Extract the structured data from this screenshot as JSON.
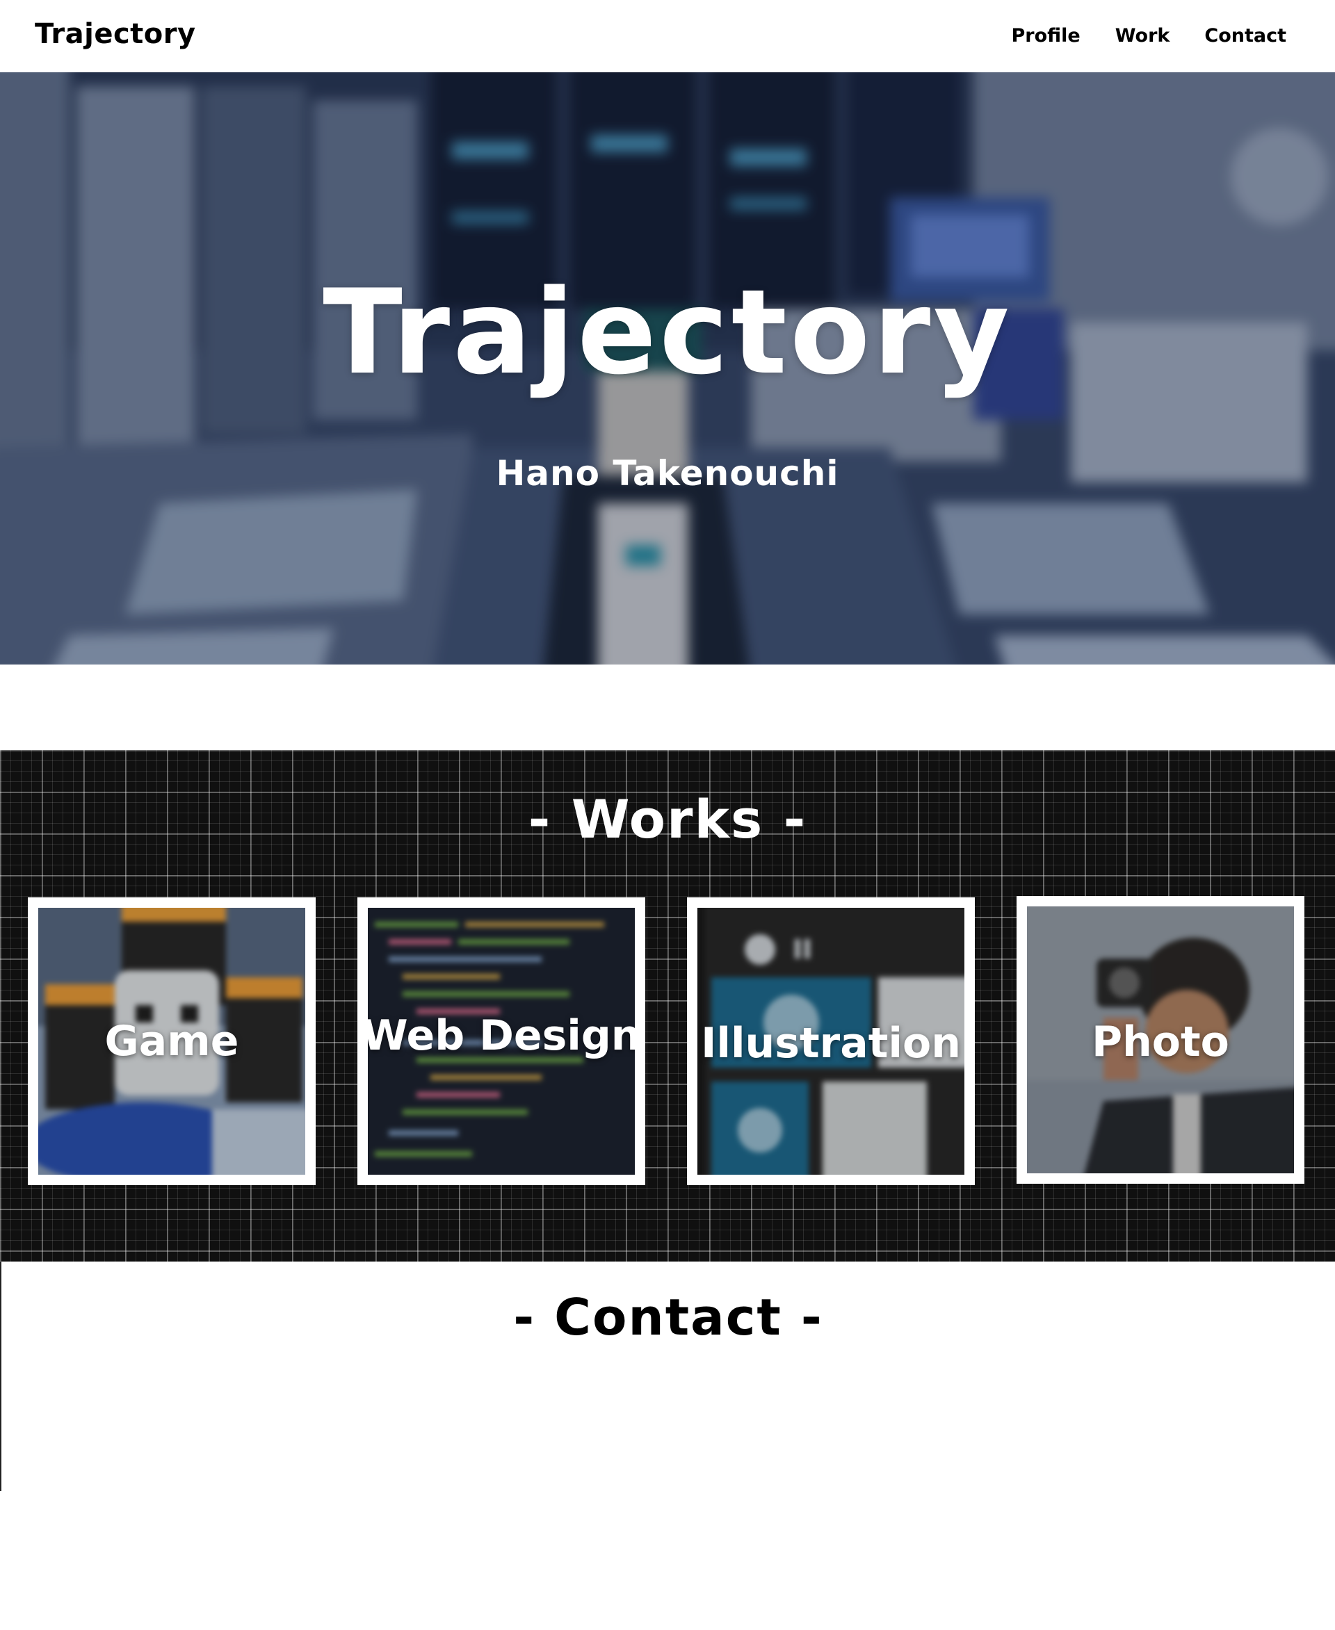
{
  "header": {
    "logo": "Trajectory",
    "nav": [
      {
        "label": "Profile"
      },
      {
        "label": "Work"
      },
      {
        "label": "Contact"
      }
    ]
  },
  "hero": {
    "title": "Trajectory",
    "subtitle": "Hano Takenouchi"
  },
  "works": {
    "title": "- Works -",
    "cards": [
      {
        "label": "Game"
      },
      {
        "label": "Web Design"
      },
      {
        "label": "Illustration"
      },
      {
        "label": "Photo"
      }
    ]
  },
  "contact": {
    "title": "- Contact -"
  },
  "colors": {
    "header_bg": "#ffffff",
    "works_bg": "#101010",
    "card_frame": "#ffffff",
    "text_dark": "#000000",
    "text_light": "#ffffff"
  }
}
